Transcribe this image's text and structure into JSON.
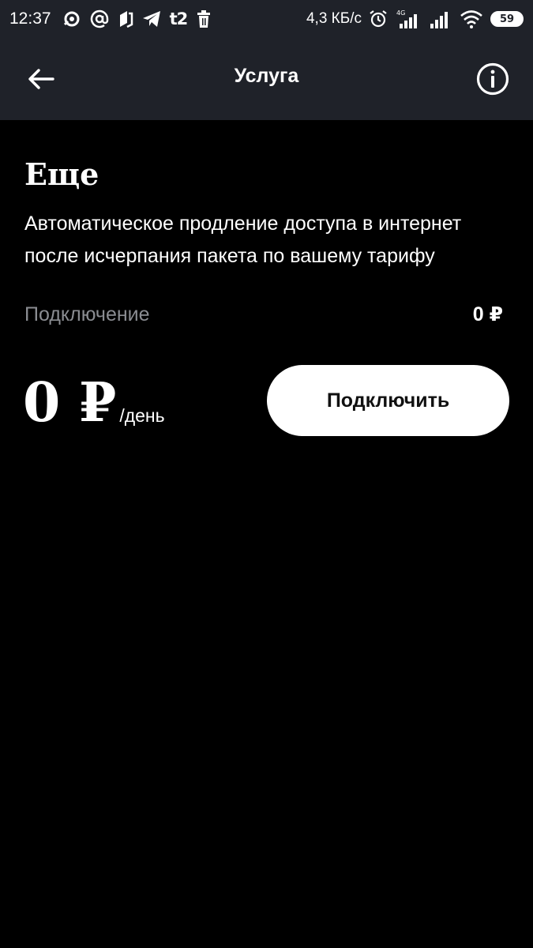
{
  "status_bar": {
    "time": "12:37",
    "carrier_badge": "t2",
    "net_speed": "4,3 КБ/с",
    "network_type": "4G",
    "battery_level": "59",
    "icons_left": [
      "sync-icon",
      "at-sign-icon",
      "notification-icon",
      "telegram-icon",
      "t2-icon",
      "trash-icon"
    ],
    "icons_right": [
      "alarm-icon",
      "signal-4g-icon",
      "signal-icon",
      "wifi-icon",
      "battery-icon"
    ]
  },
  "app_bar": {
    "title": "Услуга",
    "back_icon": "arrow-left-icon",
    "info_icon": "info-icon",
    "background": "#1f2229"
  },
  "service": {
    "name": "Еще",
    "description": "Автоматическое продление доступа в интернет после исчерпания пакета по вашему тарифу",
    "connection_label": "Подключение",
    "connection_price": "0 ₽",
    "price_amount": "0 ₽",
    "price_period": "/день",
    "connect_button_label": "Подключить"
  },
  "colors": {
    "background": "#000000",
    "muted_text": "#8a8c91",
    "button_bg": "#ffffff",
    "button_text": "#111111"
  }
}
